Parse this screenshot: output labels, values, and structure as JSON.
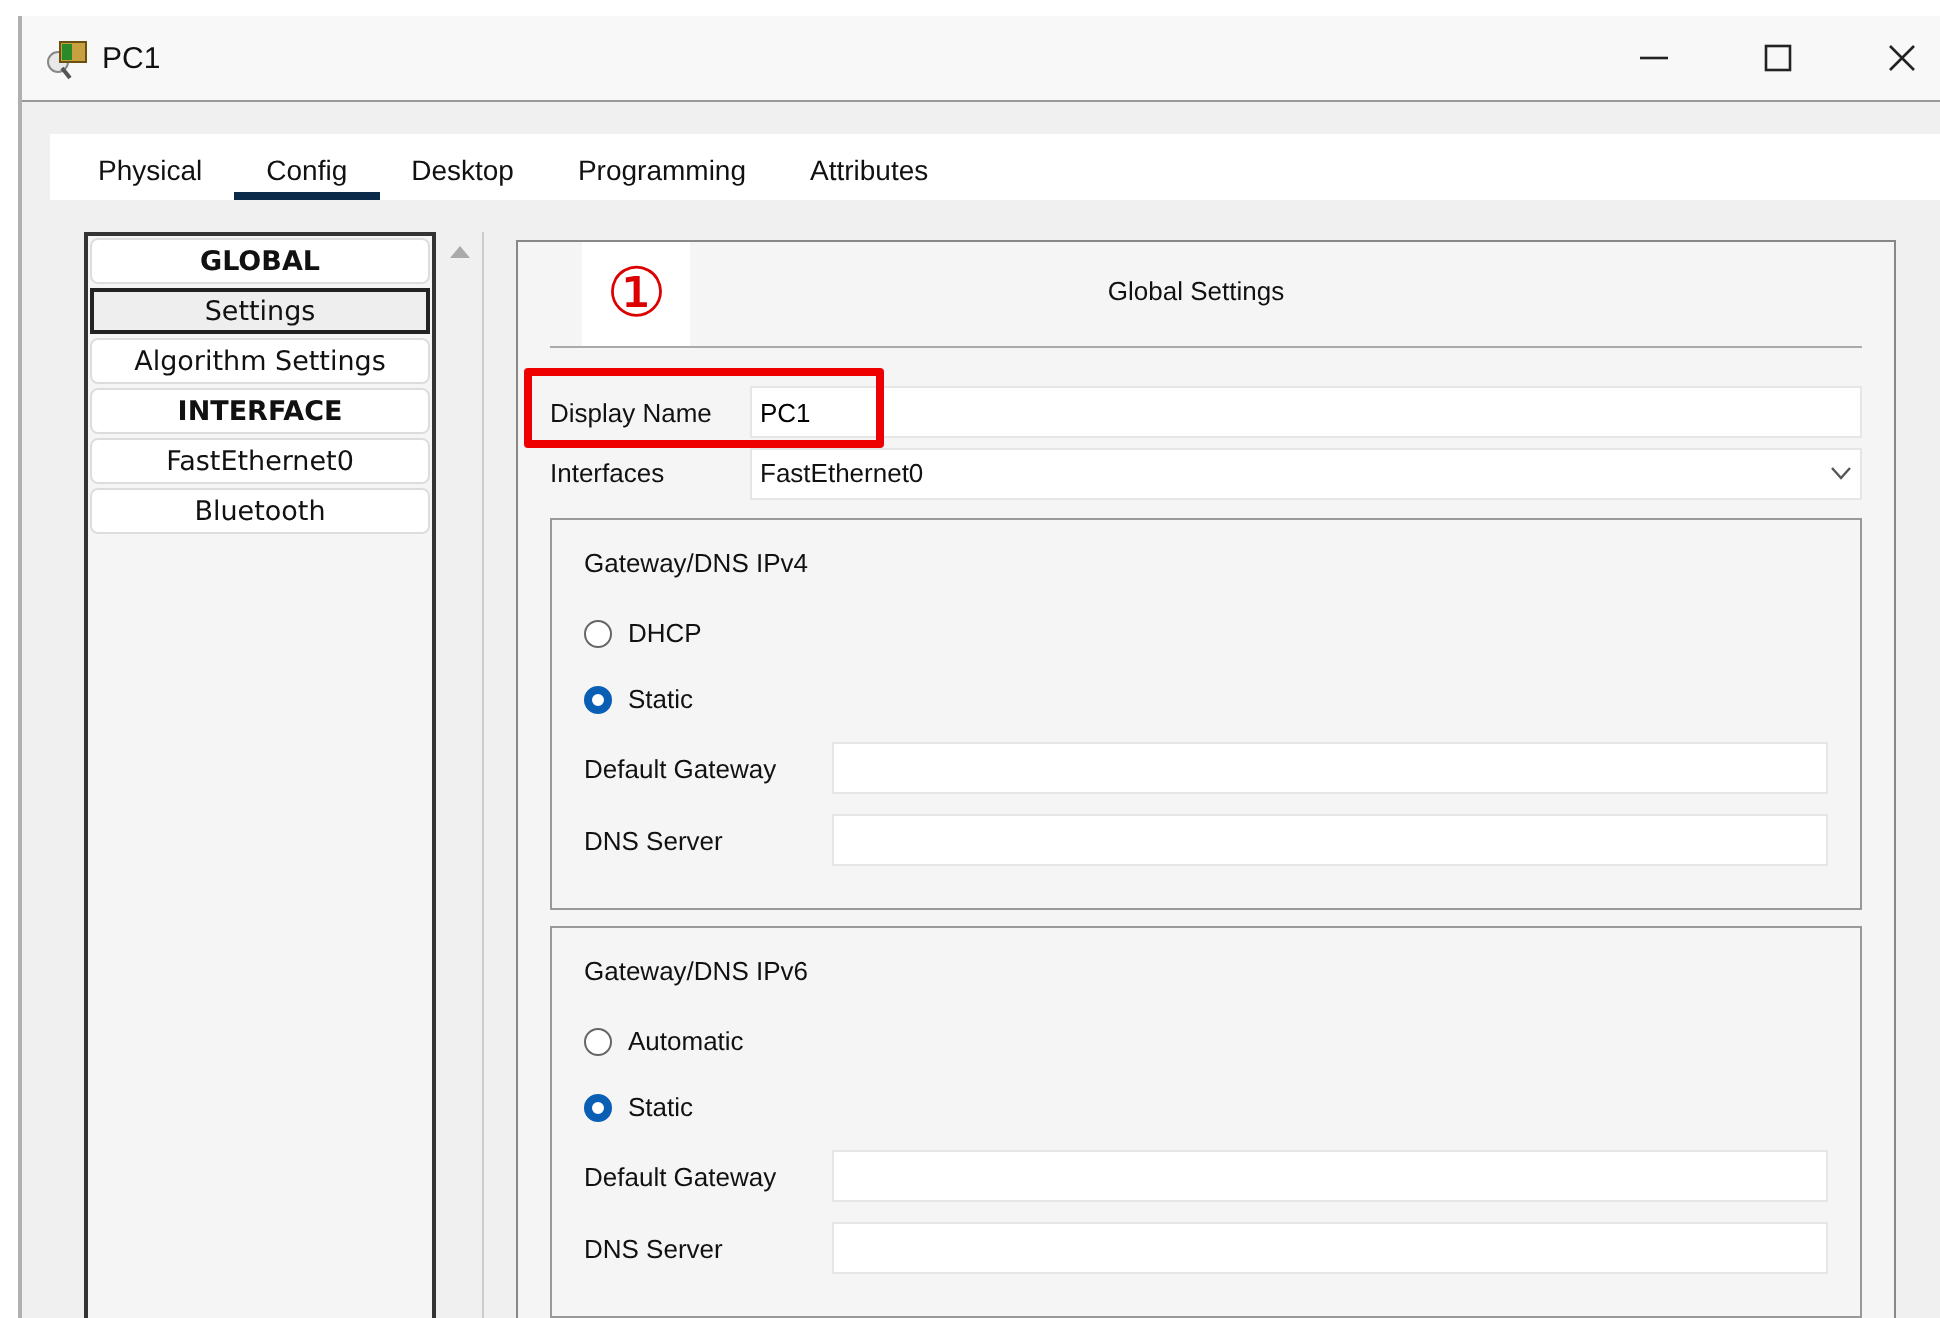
{
  "window": {
    "title": "PC1"
  },
  "tabs": [
    {
      "label": "Physical",
      "selected": false
    },
    {
      "label": "Config",
      "selected": true
    },
    {
      "label": "Desktop",
      "selected": false
    },
    {
      "label": "Programming",
      "selected": false
    },
    {
      "label": "Attributes",
      "selected": false
    }
  ],
  "sidebar": {
    "items": [
      {
        "label": "GLOBAL",
        "kind": "header",
        "selected": false
      },
      {
        "label": "Settings",
        "kind": "item",
        "selected": true
      },
      {
        "label": "Algorithm Settings",
        "kind": "item",
        "selected": false
      },
      {
        "label": "INTERFACE",
        "kind": "header",
        "selected": false
      },
      {
        "label": "FastEthernet0",
        "kind": "item",
        "selected": false
      },
      {
        "label": "Bluetooth",
        "kind": "item",
        "selected": false
      }
    ]
  },
  "callout": {
    "label": "①"
  },
  "panel": {
    "title": "Global Settings"
  },
  "display_name": {
    "label": "Display Name",
    "value": "PC1",
    "highlighted": true
  },
  "interfaces": {
    "label": "Interfaces",
    "value": "FastEthernet0"
  },
  "groups": [
    {
      "title": "Gateway/DNS IPv4",
      "options": [
        {
          "label": "DHCP",
          "selected": false
        },
        {
          "label": "Static",
          "selected": true
        }
      ],
      "fields": [
        {
          "label": "Default Gateway"
        },
        {
          "label": "DNS Server"
        }
      ]
    },
    {
      "title": "Gateway/DNS IPv6",
      "options": [
        {
          "label": "Automatic",
          "selected": false
        },
        {
          "label": "Static",
          "selected": true
        }
      ],
      "fields": [
        {
          "label": "Default Gateway"
        },
        {
          "label": "DNS Server"
        }
      ]
    }
  ]
}
